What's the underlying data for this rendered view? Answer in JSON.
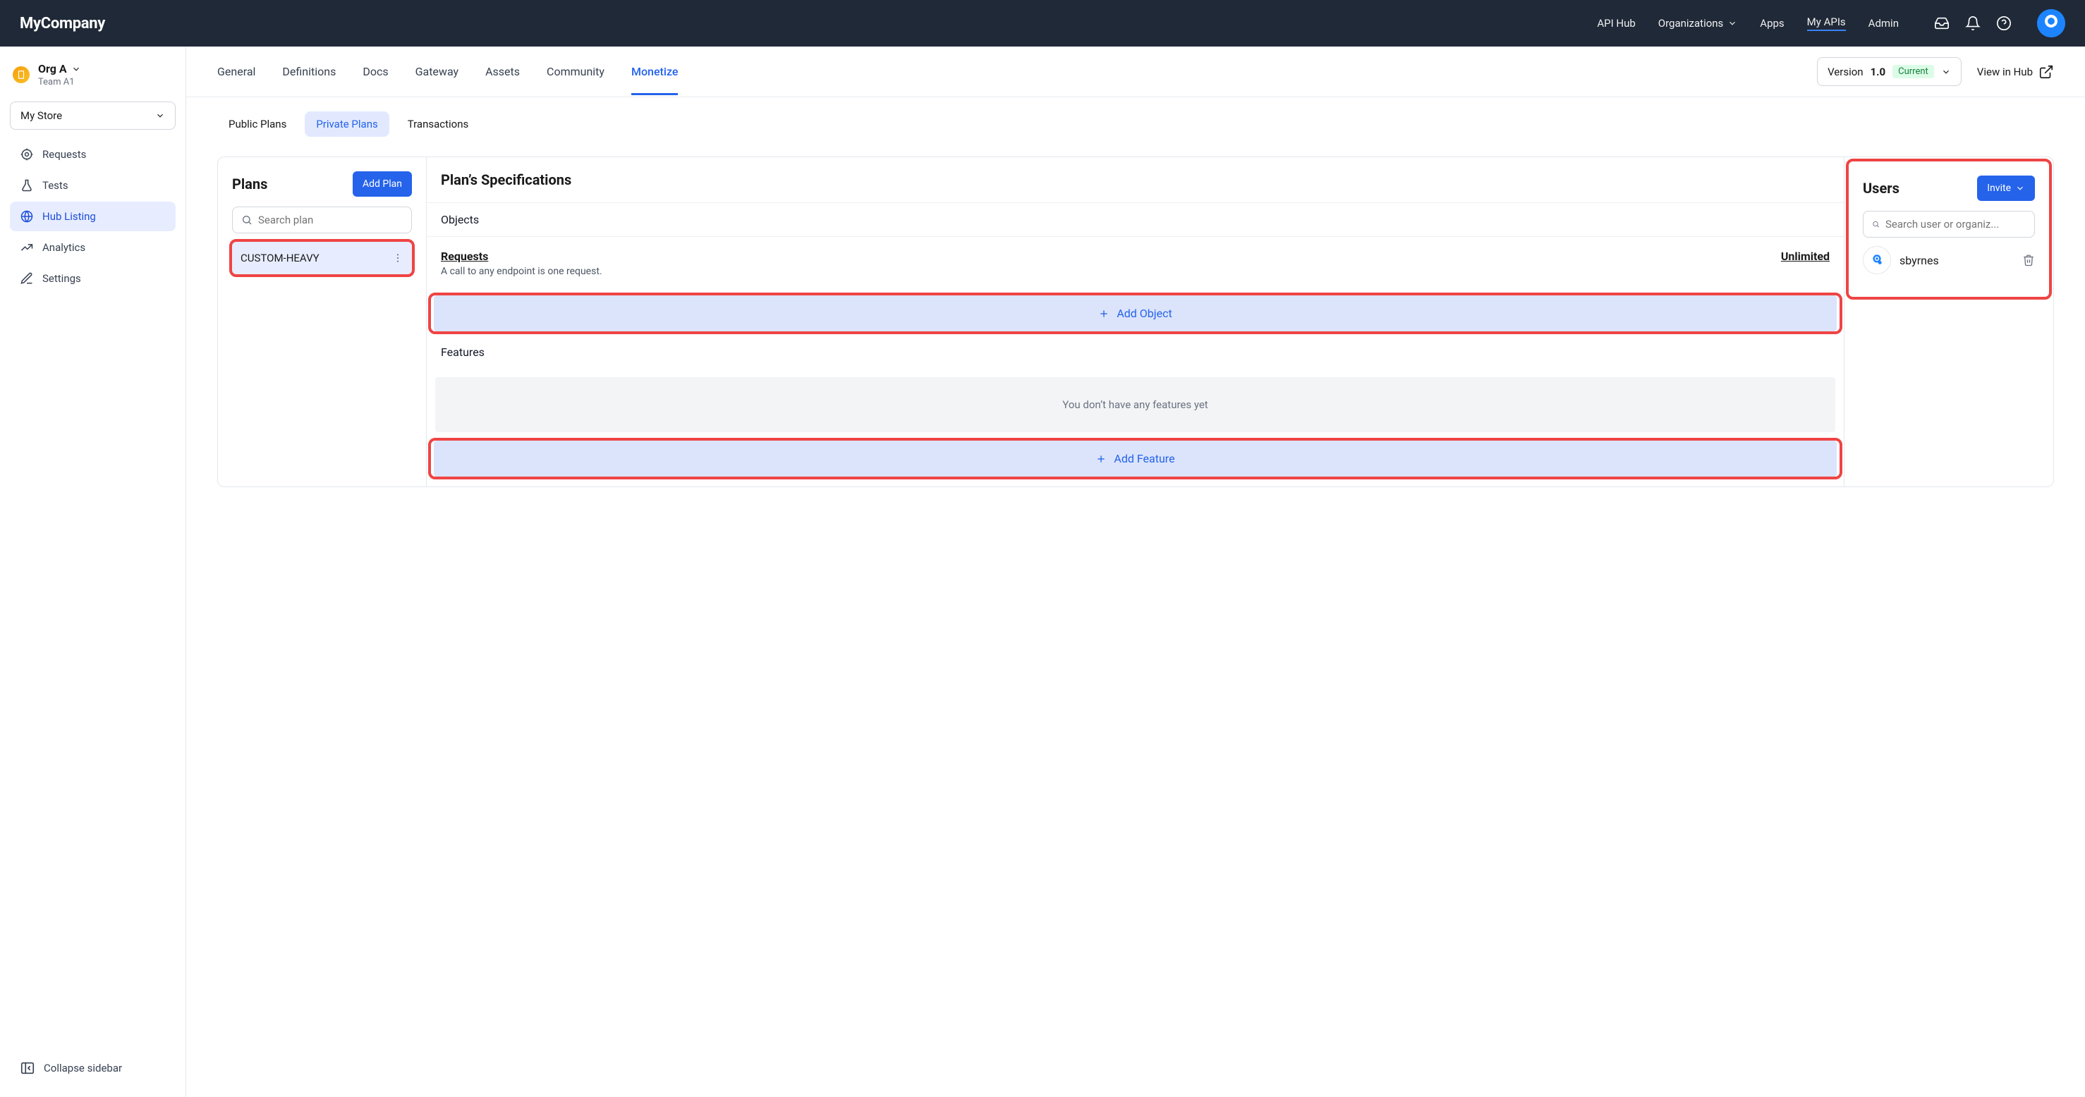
{
  "brand": "MyCompany",
  "topnav": {
    "api_hub": "API Hub",
    "organizations": "Organizations",
    "apps": "Apps",
    "my_apis": "My APIs",
    "admin": "Admin"
  },
  "sidebar": {
    "org_name": "Org A",
    "team": "Team A1",
    "store": "My Store",
    "items": {
      "requests": "Requests",
      "tests": "Tests",
      "hub_listing": "Hub Listing",
      "analytics": "Analytics",
      "settings": "Settings"
    },
    "collapse": "Collapse sidebar"
  },
  "subtabs": {
    "general": "General",
    "definitions": "Definitions",
    "docs": "Docs",
    "gateway": "Gateway",
    "assets": "Assets",
    "community": "Community",
    "monetize": "Monetize"
  },
  "version": {
    "label": "Version",
    "value": "1.0",
    "badge": "Current"
  },
  "view_in_hub": "View in Hub",
  "monetize_tabs": {
    "public": "Public Plans",
    "private": "Private Plans",
    "transactions": "Transactions"
  },
  "plans": {
    "title": "Plans",
    "add": "Add Plan",
    "search_placeholder": "Search plan",
    "items": [
      {
        "name": "CUSTOM-HEAVY"
      }
    ]
  },
  "spec": {
    "title": "Plan’s Specifications",
    "objects_title": "Objects",
    "requests_label": "Requests",
    "requests_desc": "A call to any endpoint is one request.",
    "requests_value": "Unlimited",
    "add_object": "Add Object",
    "features_title": "Features",
    "features_empty": "You don’t have any features yet",
    "add_feature": "Add Feature"
  },
  "users": {
    "title": "Users",
    "invite": "Invite",
    "search_placeholder": "Search user or organiz...",
    "list": [
      {
        "name": "sbyrnes"
      }
    ]
  }
}
